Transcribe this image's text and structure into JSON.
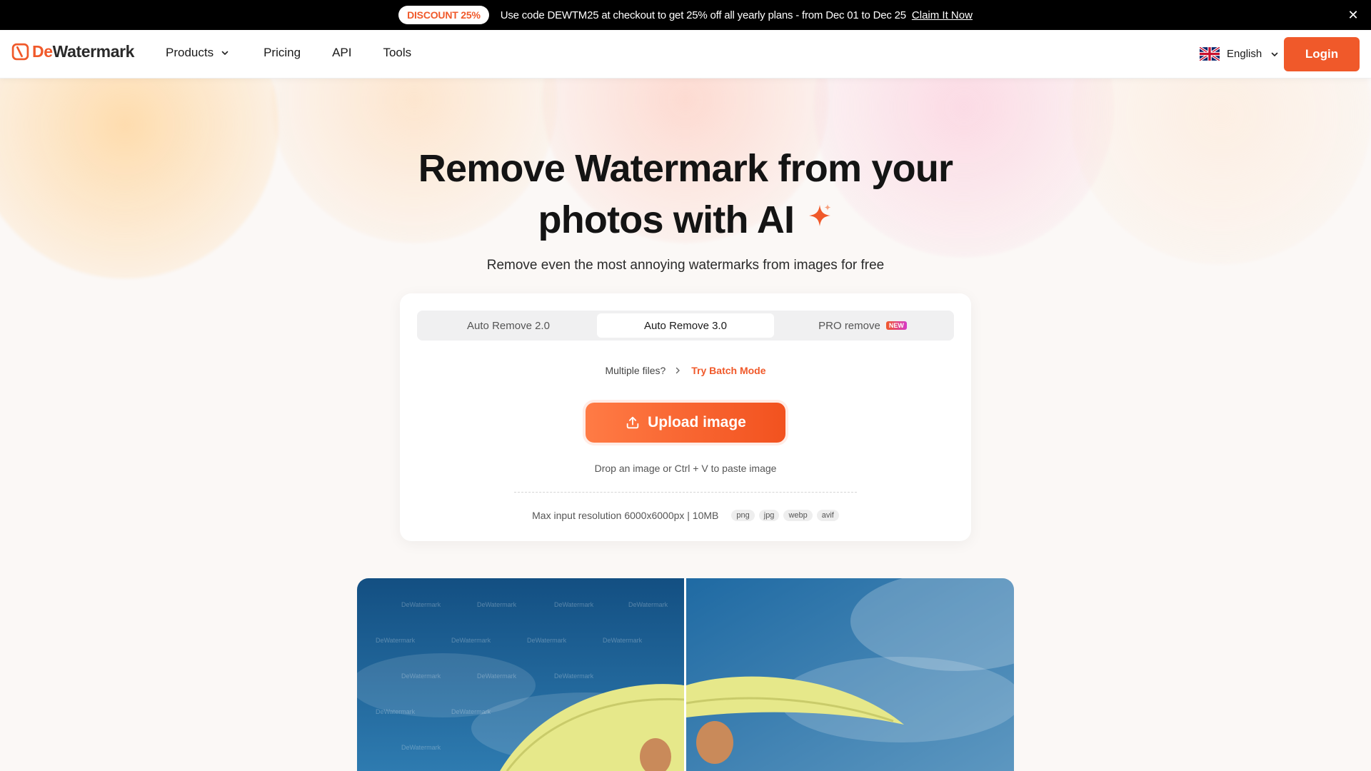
{
  "promo": {
    "badge": "DISCOUNT 25%",
    "text": "Use code DEWTM25 at checkout to get 25% off all yearly plans - from Dec 01 to Dec 25",
    "link": "Claim It Now"
  },
  "header": {
    "logo_de": "De",
    "logo_rest": "Watermark",
    "nav": {
      "products": "Products",
      "pricing": "Pricing",
      "api": "API",
      "tools": "Tools"
    },
    "language": "English",
    "login": "Login"
  },
  "hero": {
    "title_line1": "Remove Watermark from your",
    "title_line2": "photos with AI",
    "subtitle": "Remove even the most annoying watermarks from images for free"
  },
  "uploader": {
    "tabs": [
      {
        "label": "Auto Remove 2.0",
        "active": false
      },
      {
        "label": "Auto Remove 3.0",
        "active": true
      },
      {
        "label": "PRO remove",
        "active": false,
        "badge": "NEW"
      }
    ],
    "batch_prompt": "Multiple files?",
    "batch_link": "Try Batch Mode",
    "upload_label": "Upload image",
    "drop_hint": "Drop an image or Ctrl + V to paste image",
    "max_resolution": "Max input resolution 6000x6000px | 10MB",
    "formats": [
      "png",
      "jpg",
      "webp",
      "avif"
    ]
  },
  "comparison": {
    "watermark_text": "DeWatermark"
  },
  "colors": {
    "accent": "#f0592a",
    "promo_bg": "#000000",
    "tab_bg": "#f0f0f1"
  }
}
